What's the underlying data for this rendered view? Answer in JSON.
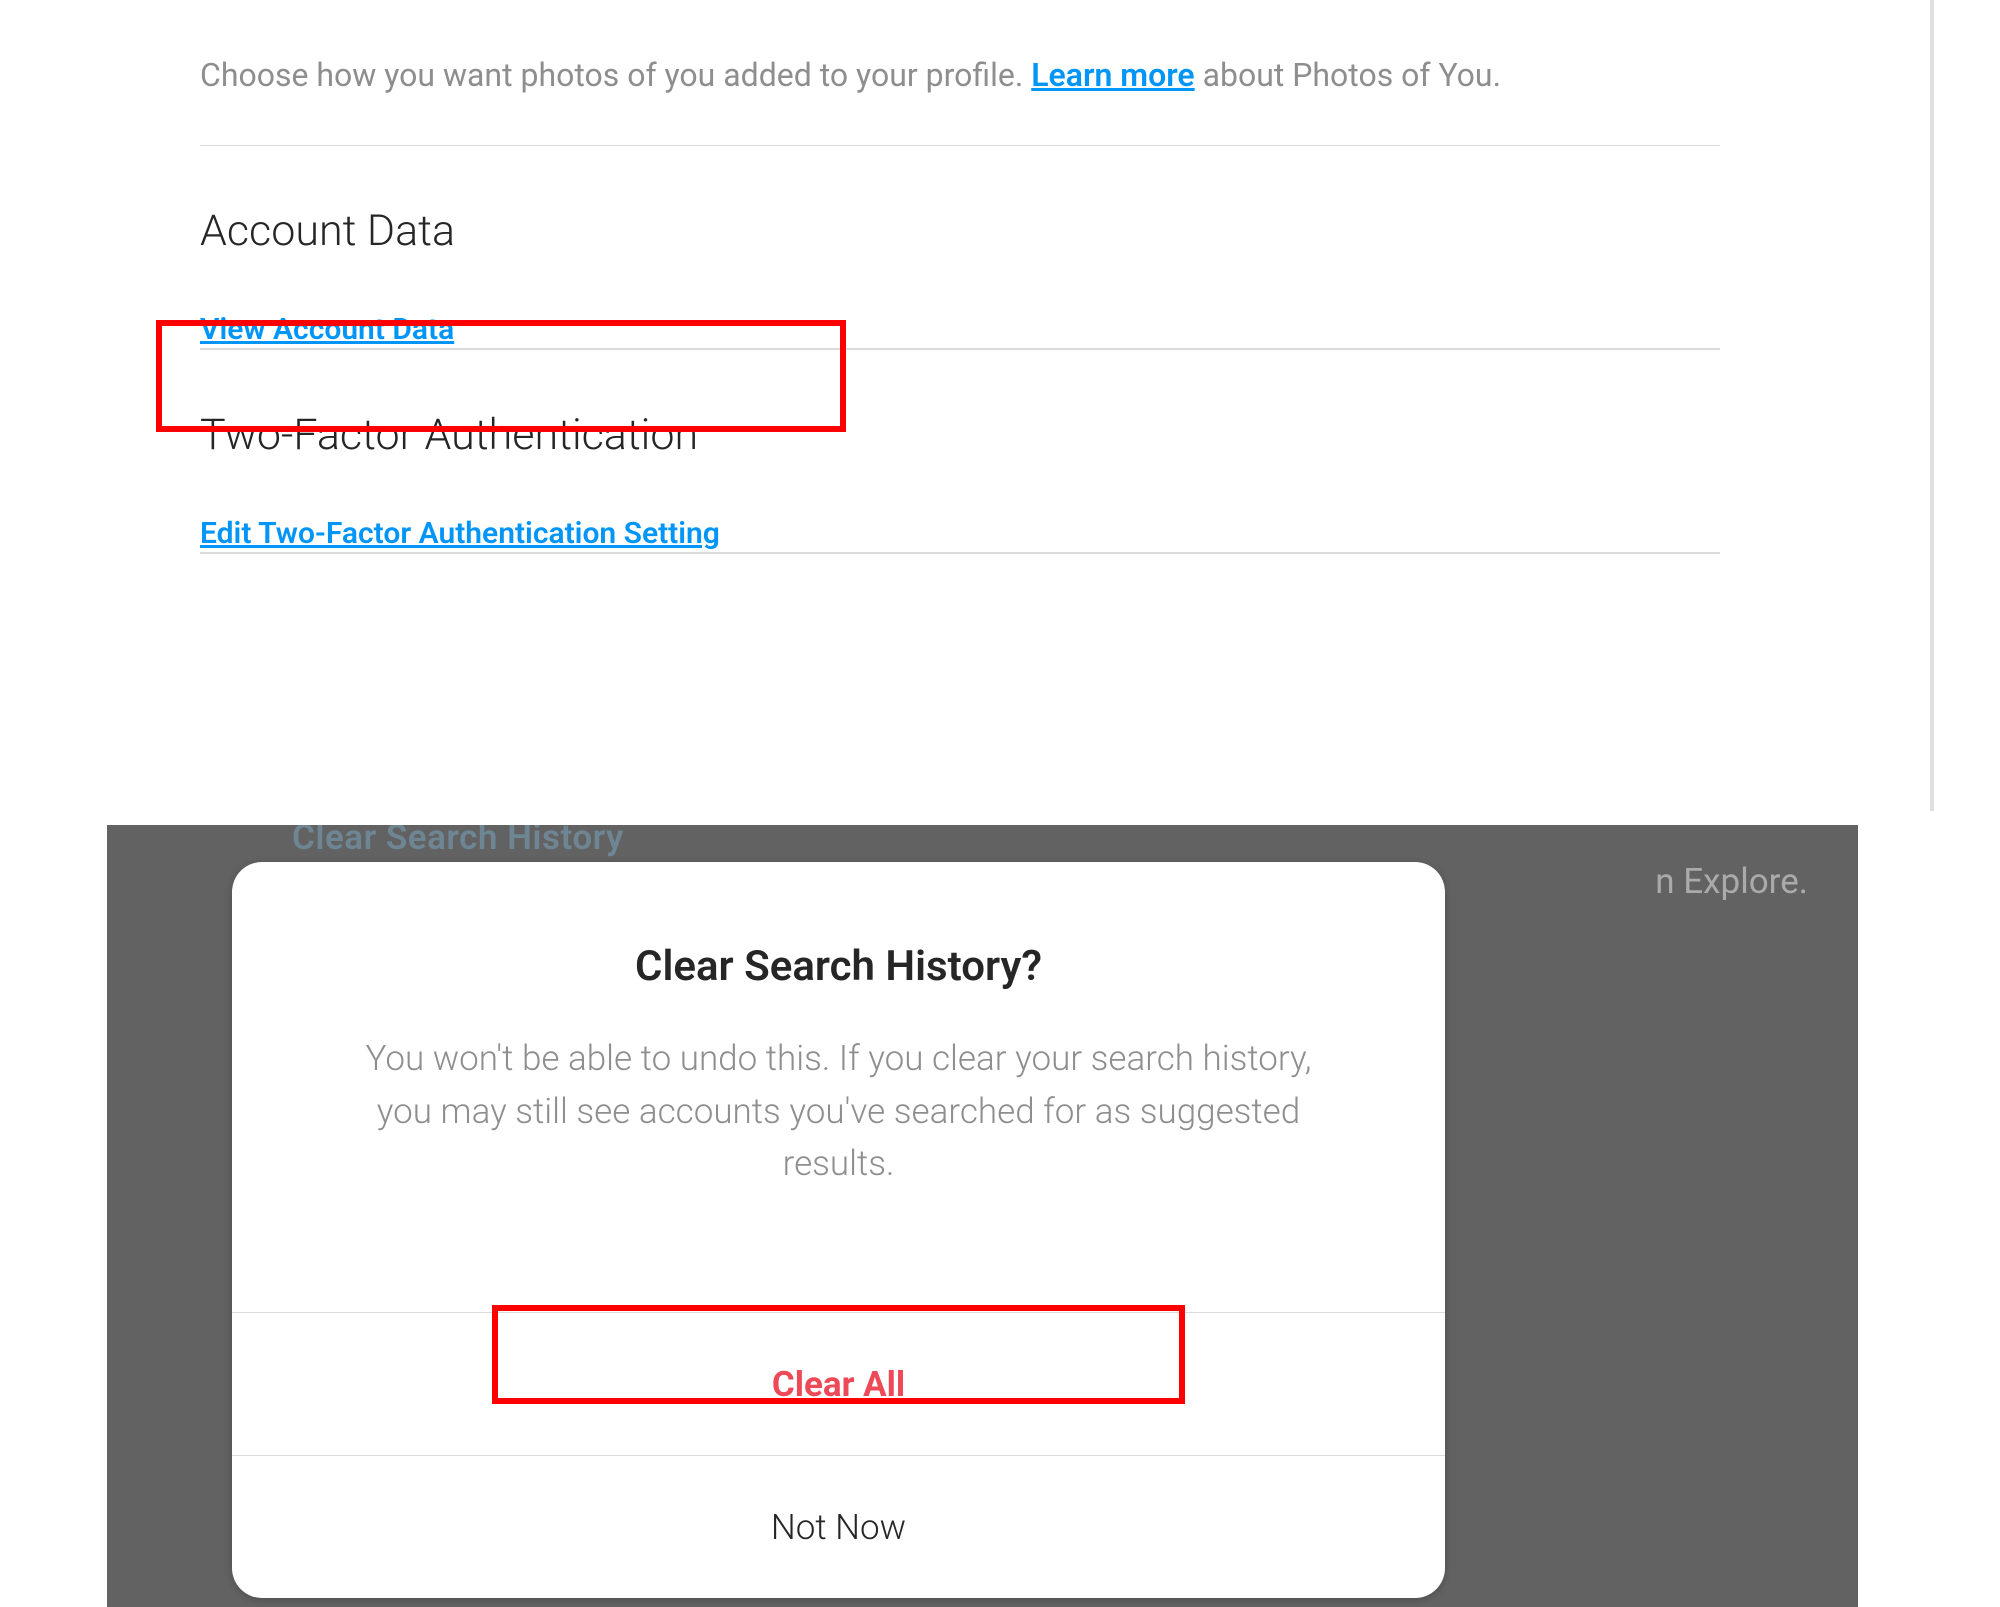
{
  "settings": {
    "photos_help_prefix": "Choose how you want photos of you added to your profile. ",
    "photos_help_link": "Learn more",
    "photos_help_suffix": " about Photos of You.",
    "sections": {
      "account_data": {
        "title": "Account Data",
        "link": "View Account Data"
      },
      "two_factor": {
        "title": "Two-Factor Authentication",
        "link": "Edit Two-Factor Authentication Setting"
      }
    }
  },
  "background": {
    "sidebar_link_partial": "Clear Search History",
    "explore_hint_partial": "n Explore."
  },
  "dialog": {
    "title": "Clear Search History?",
    "body": "You won't be able to undo this. If you clear your search history, you may still see accounts you've searched for as suggested results.",
    "clear_btn": "Clear All",
    "not_now_btn": "Not Now"
  }
}
